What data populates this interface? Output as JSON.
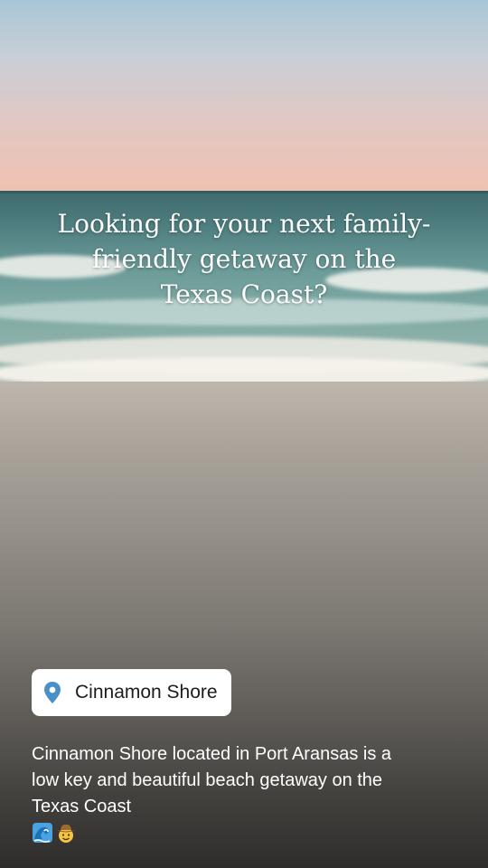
{
  "story": {
    "headline": "Looking for your next family-friendly getaway on the Texas Coast?",
    "location_sticker": {
      "icon": "location-pin-icon",
      "label": "Cinnamon Shore",
      "icon_color": "#4a90c8"
    },
    "caption": {
      "text": "Cinnamon Shore located in Port Aransas is a low key and beautiful beach getaway on the Texas Coast",
      "emojis": [
        "water-wave-emoji",
        "cowboy-face-emoji"
      ]
    }
  }
}
